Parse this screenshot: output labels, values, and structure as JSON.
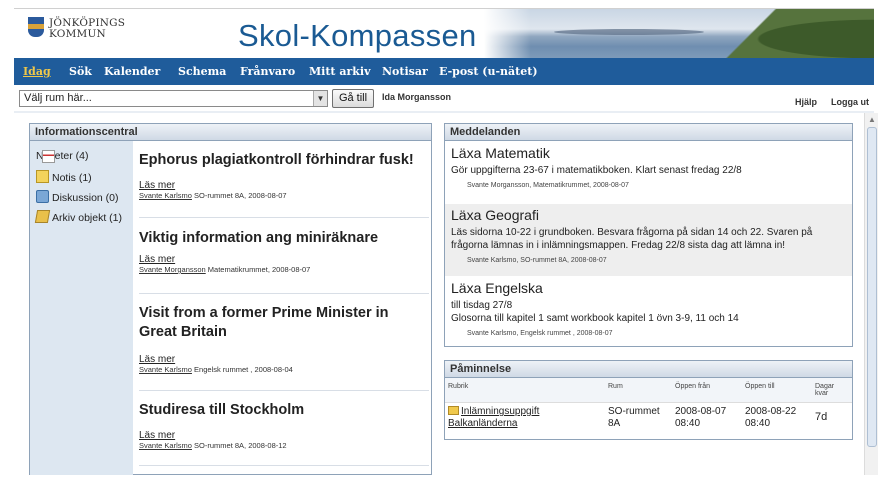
{
  "header": {
    "logo_line1": "JÖNKÖPINGS",
    "logo_line2": "KOMMUN",
    "app_title": "Skol-Kompassen"
  },
  "nav": {
    "items": [
      "Idag",
      "Sök",
      "Kalender",
      "Schema",
      "Frånvaro",
      "Mitt arkiv",
      "Notisar",
      "E-post (u-nätet)"
    ],
    "active": "Idag"
  },
  "toolbar": {
    "room_select_value": "Välj rum här...",
    "go_button": "Gå till",
    "user_name": "Ida Morgansson",
    "help": "Hjälp",
    "logout": "Logga ut"
  },
  "info_panel": {
    "title": "Informationscentral",
    "sidebar": [
      {
        "label": "Nyheter (4)",
        "icon": "news-icon"
      },
      {
        "label": "Notis (1)",
        "icon": "note-icon"
      },
      {
        "label": "Diskussion (0)",
        "icon": "discussion-icon"
      },
      {
        "label": "Arkiv objekt (1)",
        "icon": "archive-icon"
      }
    ],
    "news": [
      {
        "title": "Ephorus plagiatkontroll förhindrar fusk!",
        "more": "Läs mer",
        "author": "Svante Karlsmo",
        "meta": " SO-rummet 8A, 2008-08-07"
      },
      {
        "title": "Viktig information ang miniräknare",
        "more": "Läs mer",
        "author": "Svante Morgansson",
        "meta": " Matematikrummet, 2008-08-07"
      },
      {
        "title": "Visit from a former Prime Minister in Great Britain",
        "more": "Läs mer",
        "author": "Svante Karlsmo",
        "meta": " Engelsk rummet , 2008-08-04"
      },
      {
        "title": "Studiresa till Stockholm",
        "more": "Läs mer",
        "author": "Svante Karlsmo",
        "meta": " SO-rummet 8A, 2008-08-12"
      }
    ]
  },
  "messages_panel": {
    "title": "Meddelanden",
    "items": [
      {
        "title": "Läxa Matematik",
        "body": "Gör uppgifterna 23-67 i matematikboken. Klart senast fredag 22/8",
        "meta": "Svante Morgansson,  Matematikrummet,  2008-08-07"
      },
      {
        "title": "Läxa Geografi",
        "body": "Läs sidorna 10-22 i grundboken. Besvara frågorna på sidan 14 och 22. Svaren på frågorna lämnas in i inlämningsmappen. Fredag 22/8 sista dag att lämna in!",
        "meta": "Svante Karlsmo,  SO-rummet 8A,  2008-08-07"
      },
      {
        "title": "Läxa Engelska",
        "body": "till tisdag 27/8\nGlosorna till kapitel 1 samt workbook kapitel 1 övn 3-9, 11 och 14",
        "meta": "Svante Karlsmo,  Engelsk rummet ,  2008-08-07"
      }
    ]
  },
  "reminder_panel": {
    "title": "Påminnelse",
    "columns": [
      "Rubrik",
      "Rum",
      "Öppen från",
      "Öppen till",
      "Dagar kvar"
    ],
    "rows": [
      {
        "subject": "Inlämningsuppgift Balkanländerna",
        "room": "SO-rummet 8A",
        "open_from": "2008-08-07 08:40",
        "open_to": "2008-08-22 08:40",
        "days_left": "7d"
      }
    ]
  },
  "colors": {
    "nav_bg": "#1f5c9b",
    "title_blue": "#1a5a93",
    "panel_border": "#8ea2b8",
    "sidebar_bg": "#dde7f1",
    "active_nav": "#f0c84a"
  }
}
